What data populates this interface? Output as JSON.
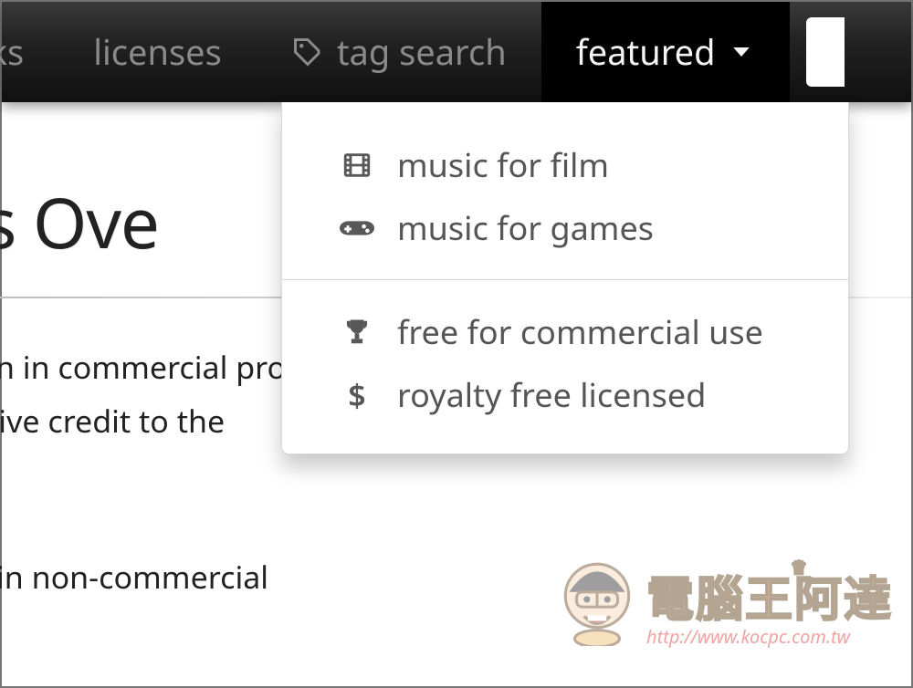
{
  "nav": {
    "items": [
      {
        "id": "tracks",
        "label": "rks",
        "icon": null,
        "active": false
      },
      {
        "id": "licenses",
        "label": "licenses",
        "icon": null,
        "active": false
      },
      {
        "id": "tagsearch",
        "label": "tag search",
        "icon": "tag-icon",
        "active": false
      },
      {
        "id": "featured",
        "label": "featured",
        "icon": "chevron-down-icon",
        "active": true
      }
    ]
  },
  "dropdown": {
    "groups": [
      [
        {
          "id": "film",
          "label": "music for film",
          "icon": "film-icon"
        },
        {
          "id": "games",
          "label": "music for games",
          "icon": "gamepad-icon"
        }
      ],
      [
        {
          "id": "commercial",
          "label": "free for commercial use",
          "icon": "trophy-icon"
        },
        {
          "id": "royalty",
          "label": "royalty free licensed",
          "icon": "dollar-icon"
        }
      ]
    ]
  },
  "page": {
    "heading": "es Ove",
    "para1_line1": "even in commercial projects",
    "para1_line2": "st give credit to the",
    "para2_line1": "nly in non-commercial"
  },
  "watermark": {
    "text": "電腦王阿達",
    "url": "http://www.kocpc.com.tw"
  }
}
